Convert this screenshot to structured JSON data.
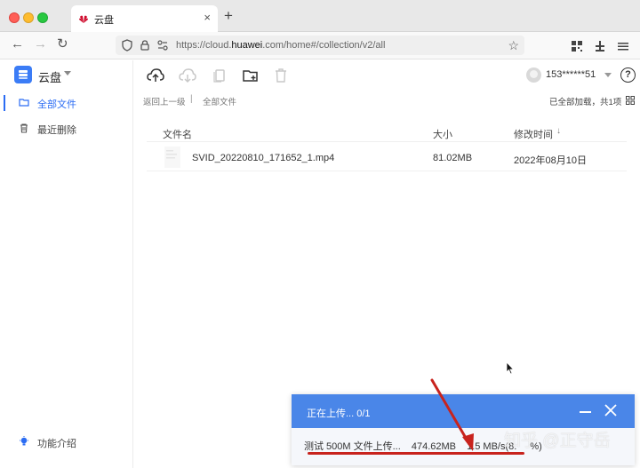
{
  "browser": {
    "tab_title": "云盘",
    "tab_close": "×",
    "new_tab": "+",
    "url_prefix": "https://cloud.",
    "url_domain": "huawei",
    "url_suffix": ".com/home#/collection/v2/all"
  },
  "sidebar": {
    "app_name": "云盘",
    "items": [
      {
        "label": "全部文件",
        "icon": "folder-icon",
        "active": true
      },
      {
        "label": "最近删除",
        "icon": "trash-icon",
        "active": false
      }
    ],
    "feature_intro": "功能介绍"
  },
  "toolbar": {
    "user_name": "153******51",
    "help": "?"
  },
  "breadcrumb": {
    "back": "返回上一级",
    "separator": "|",
    "current": "全部文件",
    "loaded_status": "已全部加载，共1项"
  },
  "table": {
    "headers": {
      "name": "文件名",
      "size": "大小",
      "modified": "修改时间",
      "sort_indicator": "↓"
    },
    "rows": [
      {
        "name": "SVID_20220810_171652_1.mp4",
        "size": "81.02MB",
        "modified": "2022年08月10日"
      }
    ]
  },
  "upload_panel": {
    "title": "正在上传... 0/1",
    "file_name": "测试 500M 文件上传...",
    "size": "474.62MB",
    "speed": "1.5 MB/s(8.",
    "speed_tail": "%)"
  },
  "watermark": "知乎 @正守岳",
  "colors": {
    "accent": "#2b6cf3",
    "upload_header": "#4a86e8",
    "annotation_red": "#c8231d"
  }
}
